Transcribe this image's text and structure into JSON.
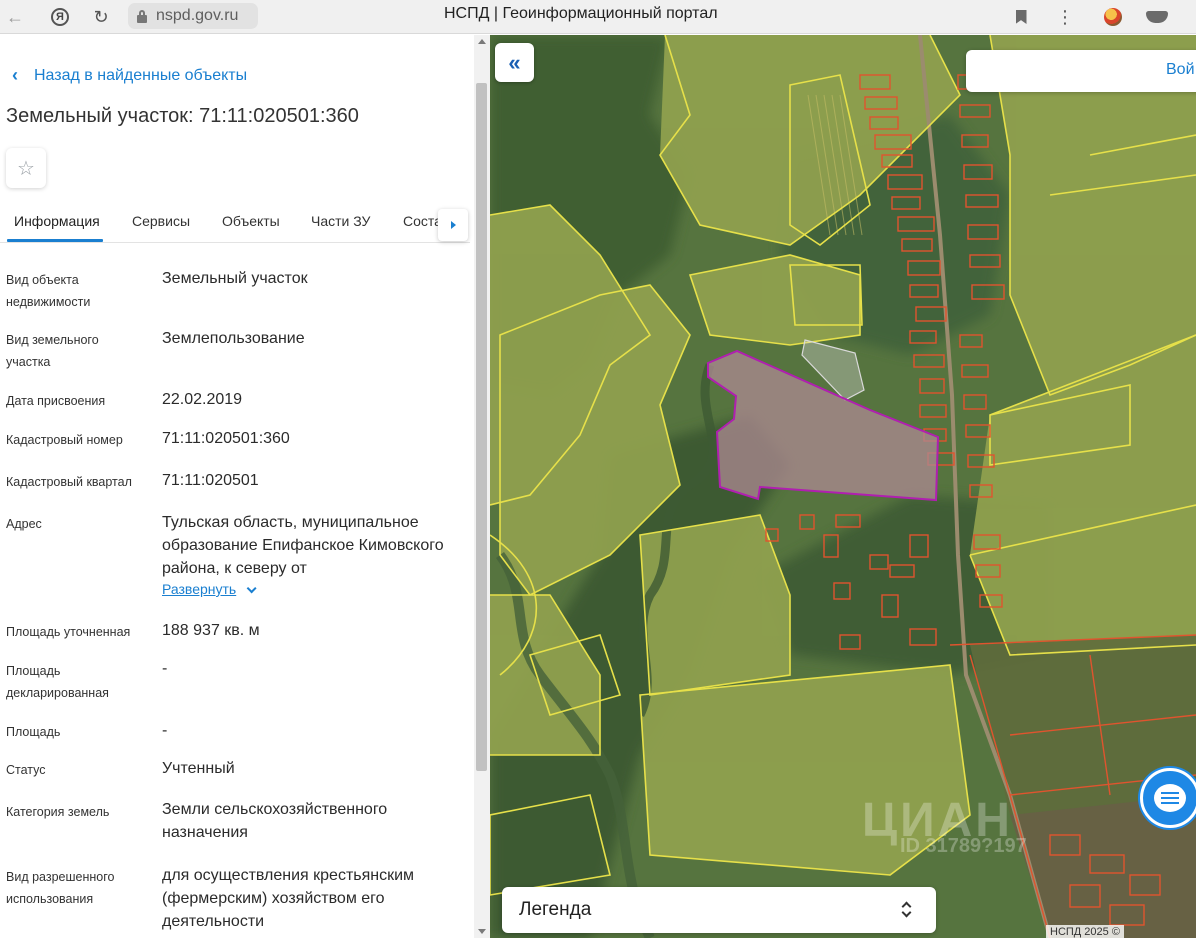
{
  "browser": {
    "url": "nspd.gov.ru",
    "title": "НСПД | Геоинформационный портал"
  },
  "panel": {
    "back_link": "Назад в найденные объекты",
    "title": "Земельный участок: 71:11:020501:360",
    "tabs": [
      {
        "label": "Информация",
        "active": true
      },
      {
        "label": "Сервисы"
      },
      {
        "label": "Объекты"
      },
      {
        "label": "Части ЗУ"
      },
      {
        "label": "Соста"
      }
    ],
    "properties": [
      {
        "label": "Вид объекта недвижимости",
        "value": "Земельный участок"
      },
      {
        "label": "Вид земельного участка",
        "value": "Землепользование"
      },
      {
        "label": "Дата присвоения",
        "value": "22.02.2019"
      },
      {
        "label": "Кадастровый номер",
        "value": "71:11:020501:360"
      },
      {
        "label": "Кадастровый квартал",
        "value": "71:11:020501"
      },
      {
        "label": "Адрес",
        "value": "Тульская область, муниципальное образование Епифанское Кимовского района, к северу от"
      },
      {
        "label": "Площадь уточненная",
        "value": "188 937 кв. м"
      },
      {
        "label": "Площадь декларированная",
        "value": "-"
      },
      {
        "label": "Площадь",
        "value": "-"
      },
      {
        "label": "Статус",
        "value": "Учтенный"
      },
      {
        "label": "Категория земель",
        "value": "Земли сельскохозяйственного назначения"
      },
      {
        "label": "Вид разрешенного использования",
        "value": "для осуществления крестьянским (фермерским) хозяйством его деятельности"
      }
    ],
    "expand_label": "Развернуть"
  },
  "map": {
    "login_label": "Вой",
    "legend_label": "Легенда",
    "watermark": "ЦИАН",
    "watermark_id": "ID 31789?197",
    "copyright": "НСПД 2025 ©",
    "colors": {
      "parcel_outline": "#e0542e",
      "field_outline": "#e6e04a",
      "selected_outline": "#b01fb0",
      "accent": "#1a7fd0"
    }
  }
}
